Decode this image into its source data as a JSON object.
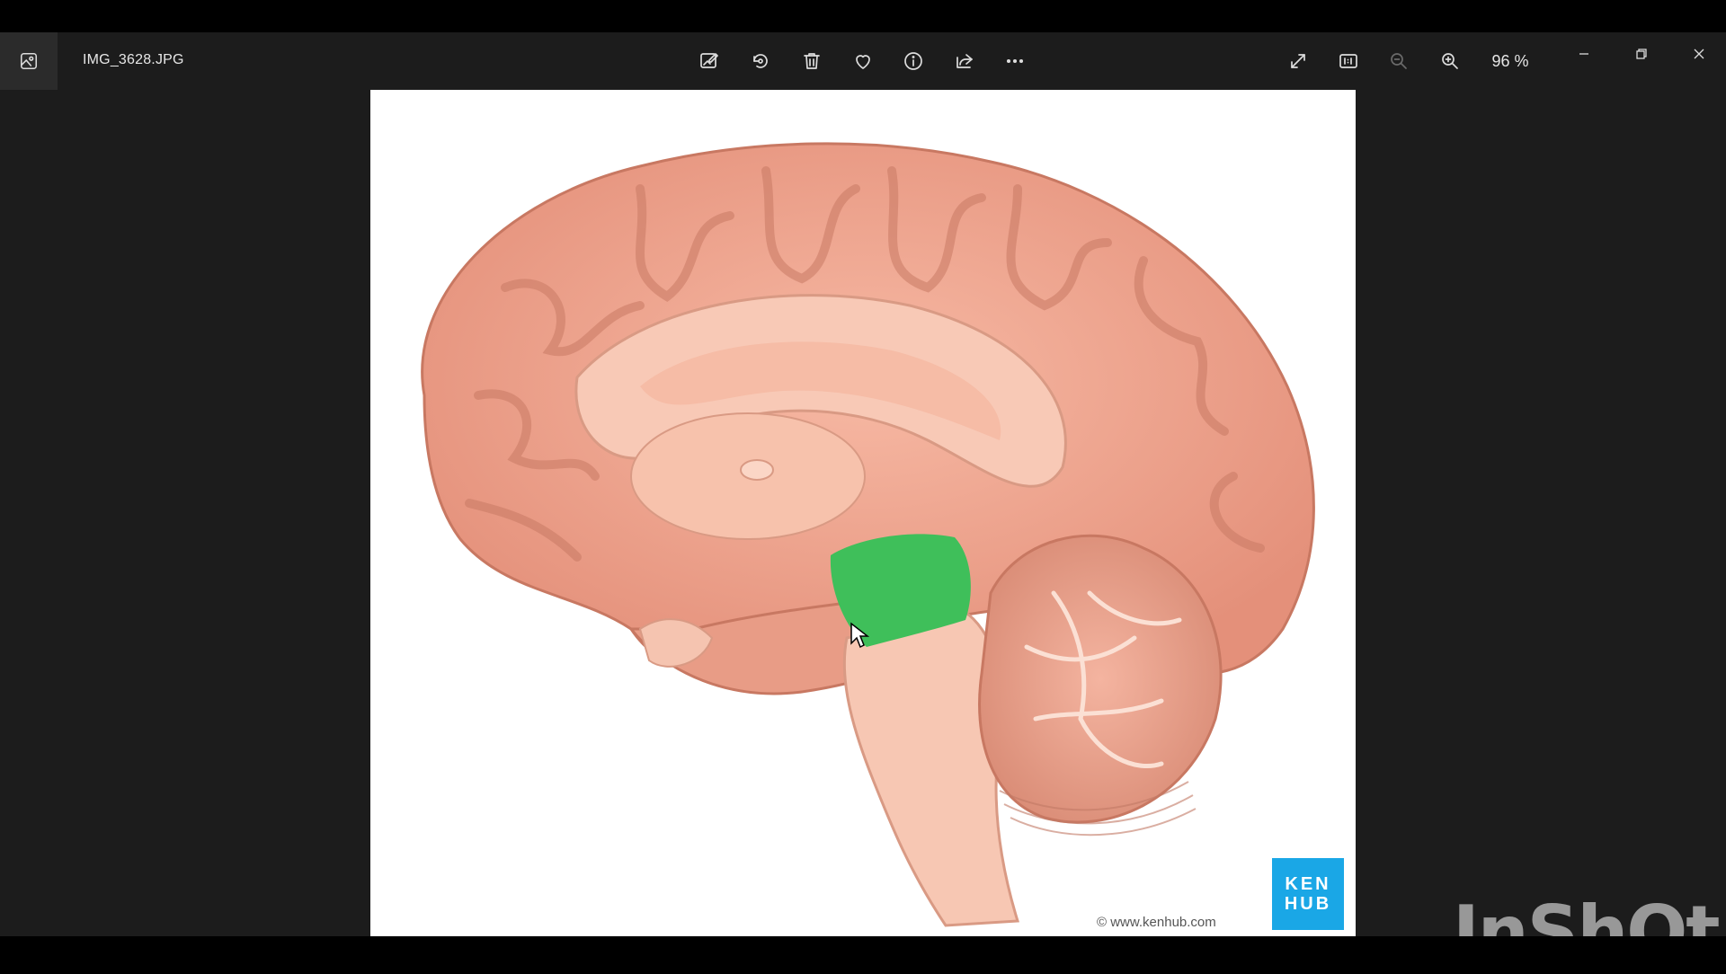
{
  "window": {
    "filename": "IMG_3628.JPG",
    "zoom": "96 %"
  },
  "toolbar": {
    "icons": [
      "edit-image-icon",
      "rotate-icon",
      "delete-icon",
      "favorite-icon",
      "info-icon",
      "share-icon",
      "more-icon"
    ],
    "right_icons": [
      "fullscreen-icon",
      "actual-size-icon",
      "zoom-out-icon",
      "zoom-in-icon"
    ]
  },
  "image": {
    "logo_line1": "KEN",
    "logo_line2": "HUB",
    "copyright": "© www.kenhub.com",
    "highlight_color": "#3fbf5a",
    "brain_color": "#f0a58e"
  },
  "watermark": "InShOt"
}
